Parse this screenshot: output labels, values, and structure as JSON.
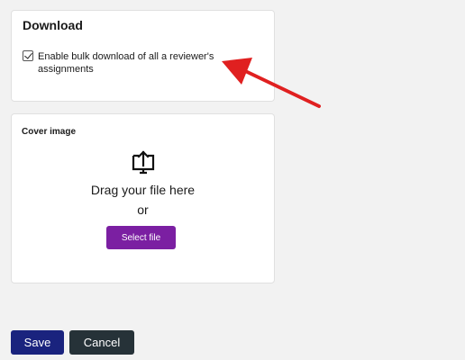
{
  "download": {
    "title": "Download",
    "bulk_checkbox": {
      "label": "Enable bulk download of all a reviewer's assignments",
      "checked": true
    }
  },
  "cover": {
    "title": "Cover image",
    "upload_icon": "upload-to-monitor-icon",
    "drag_text": "Drag your file here",
    "or_text": "or",
    "select_button": "Select file"
  },
  "actions": {
    "save_label": "Save",
    "cancel_label": "Cancel"
  },
  "colors": {
    "select_button": "#7b1fa2",
    "save_button": "#1a237e",
    "cancel_button": "#263238",
    "annotation_arrow": "#e02020",
    "background": "#f2f2f2"
  },
  "annotation": {
    "icon": "red-arrow-icon"
  }
}
